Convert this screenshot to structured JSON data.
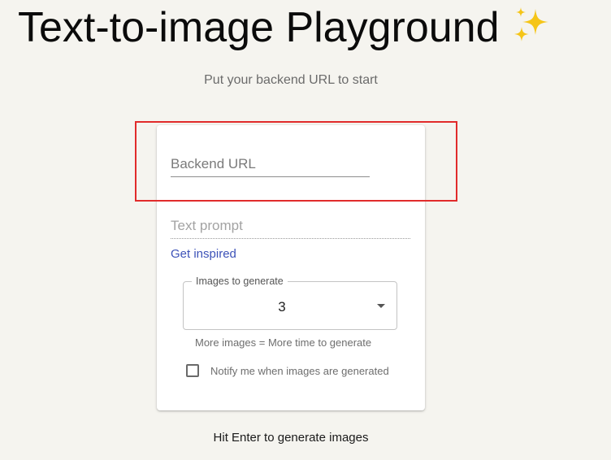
{
  "header": {
    "title": "Text-to-image Playground",
    "title_icon": "sparkles-icon",
    "subtitle": "Put your backend URL to start"
  },
  "form": {
    "backend_url": {
      "placeholder": "Backend URL",
      "value": ""
    },
    "text_prompt": {
      "placeholder": "Text prompt",
      "value": ""
    },
    "inspire_link": "Get inspired",
    "images_select": {
      "label": "Images to generate",
      "selected": "3"
    },
    "helper_text": "More images = More time to generate",
    "notify": {
      "label": "Notify me when images are generated",
      "checked": false
    }
  },
  "footer": {
    "hint": "Hit Enter to generate images"
  },
  "colors": {
    "background": "#f5f4ef",
    "link": "#3d52b8",
    "highlight": "#e12b2b",
    "sparkle": "#f5c518"
  }
}
